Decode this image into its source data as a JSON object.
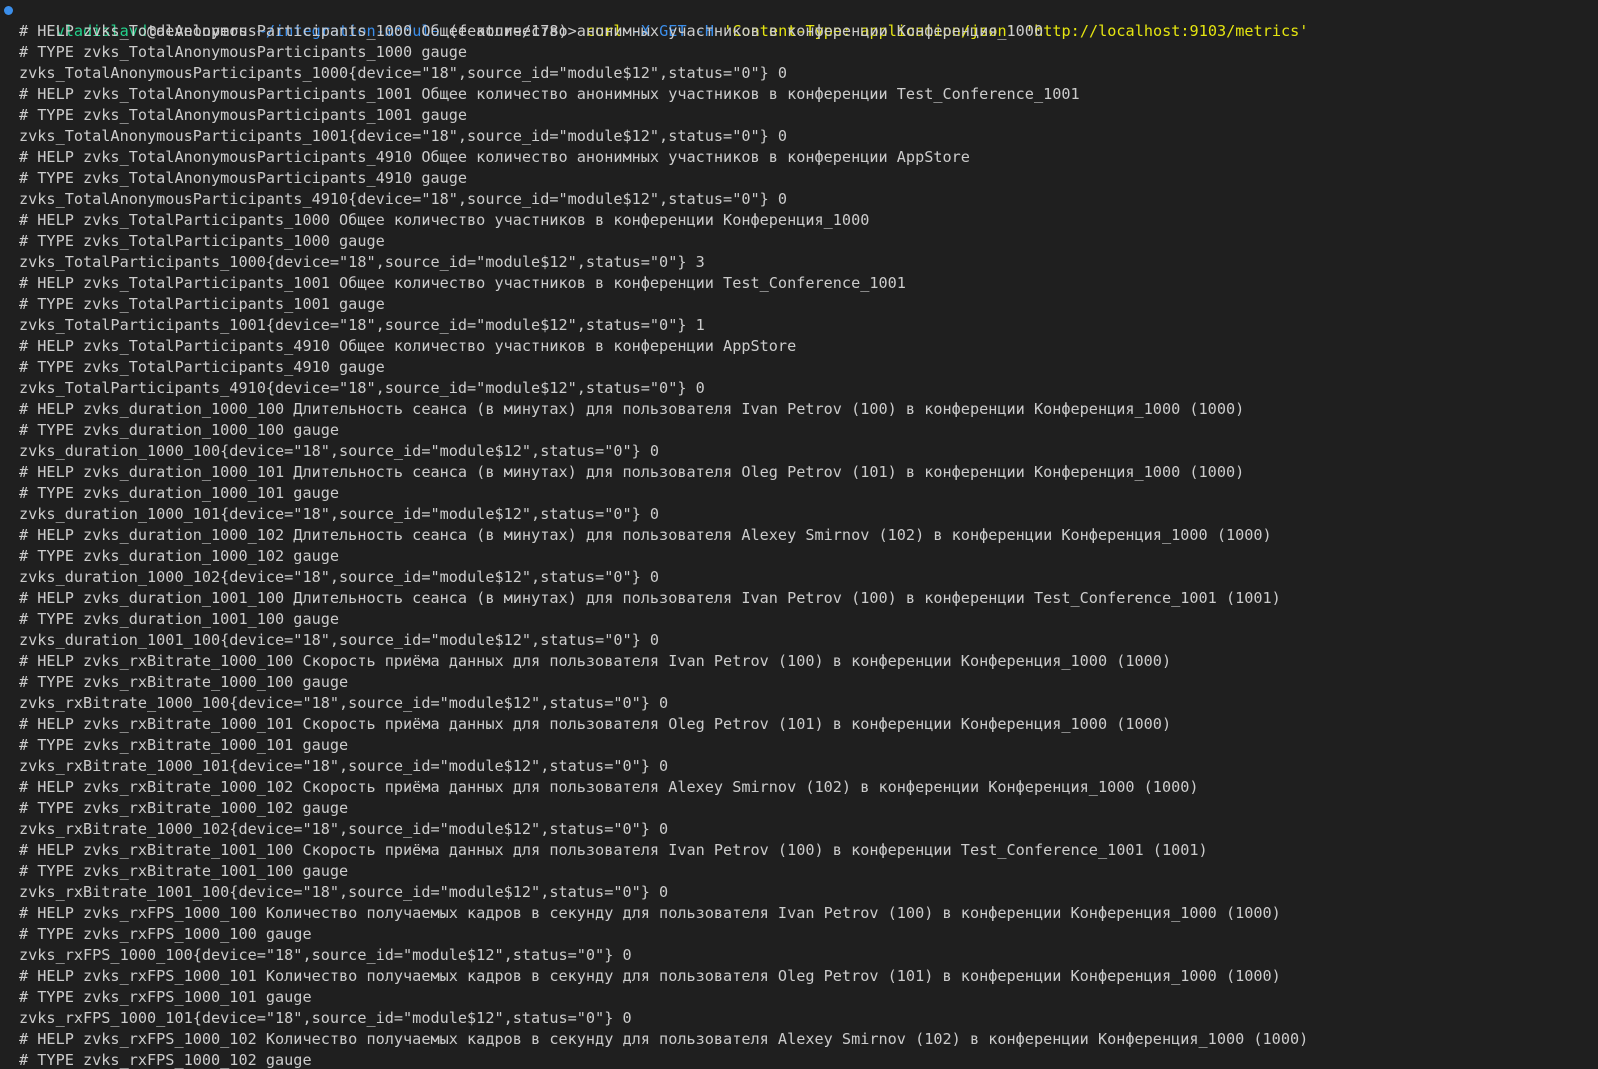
{
  "terminal": {
    "colors": {
      "background": "#1f1f1f",
      "foreground": "#cccccc",
      "prompt_dot": "#3b8eea"
    },
    "prompt": {
      "user": "vladislavd",
      "at_host": "@developers",
      "path": "~/integration-module",
      "branch": "(feature/178)>",
      "command": "curl",
      "flag_x": "-X",
      "method": "GET",
      "flag_h": "-H",
      "header": "'Content-Type: application/json'",
      "url": "'http://localhost:9103/metrics'"
    },
    "output": [
      "# HELP zvks_TotalAnonymousParticipants_1000 Общее количество анонимных участников в конференции Конференция_1000",
      "# TYPE zvks_TotalAnonymousParticipants_1000 gauge",
      "zvks_TotalAnonymousParticipants_1000{device=\"18\",source_id=\"module$12\",status=\"0\"} 0",
      "# HELP zvks_TotalAnonymousParticipants_1001 Общее количество анонимных участников в конференции Test_Conference_1001",
      "# TYPE zvks_TotalAnonymousParticipants_1001 gauge",
      "zvks_TotalAnonymousParticipants_1001{device=\"18\",source_id=\"module$12\",status=\"0\"} 0",
      "# HELP zvks_TotalAnonymousParticipants_4910 Общее количество анонимных участников в конференции AppStore",
      "# TYPE zvks_TotalAnonymousParticipants_4910 gauge",
      "zvks_TotalAnonymousParticipants_4910{device=\"18\",source_id=\"module$12\",status=\"0\"} 0",
      "# HELP zvks_TotalParticipants_1000 Общее количество участников в конференции Конференция_1000",
      "# TYPE zvks_TotalParticipants_1000 gauge",
      "zvks_TotalParticipants_1000{device=\"18\",source_id=\"module$12\",status=\"0\"} 3",
      "# HELP zvks_TotalParticipants_1001 Общее количество участников в конференции Test_Conference_1001",
      "# TYPE zvks_TotalParticipants_1001 gauge",
      "zvks_TotalParticipants_1001{device=\"18\",source_id=\"module$12\",status=\"0\"} 1",
      "# HELP zvks_TotalParticipants_4910 Общее количество участников в конференции AppStore",
      "# TYPE zvks_TotalParticipants_4910 gauge",
      "zvks_TotalParticipants_4910{device=\"18\",source_id=\"module$12\",status=\"0\"} 0",
      "# HELP zvks_duration_1000_100 Длительность сеанса (в минутах) для пользователя Ivan Petrov (100) в конференции Конференция_1000 (1000)",
      "# TYPE zvks_duration_1000_100 gauge",
      "zvks_duration_1000_100{device=\"18\",source_id=\"module$12\",status=\"0\"} 0",
      "# HELP zvks_duration_1000_101 Длительность сеанса (в минутах) для пользователя Oleg Petrov (101) в конференции Конференция_1000 (1000)",
      "# TYPE zvks_duration_1000_101 gauge",
      "zvks_duration_1000_101{device=\"18\",source_id=\"module$12\",status=\"0\"} 0",
      "# HELP zvks_duration_1000_102 Длительность сеанса (в минутах) для пользователя Alexey Smirnov (102) в конференции Конференция_1000 (1000)",
      "# TYPE zvks_duration_1000_102 gauge",
      "zvks_duration_1000_102{device=\"18\",source_id=\"module$12\",status=\"0\"} 0",
      "# HELP zvks_duration_1001_100 Длительность сеанса (в минутах) для пользователя Ivan Petrov (100) в конференции Test_Conference_1001 (1001)",
      "# TYPE zvks_duration_1001_100 gauge",
      "zvks_duration_1001_100{device=\"18\",source_id=\"module$12\",status=\"0\"} 0",
      "# HELP zvks_rxBitrate_1000_100 Скорость приёма данных для пользователя Ivan Petrov (100) в конференции Конференция_1000 (1000)",
      "# TYPE zvks_rxBitrate_1000_100 gauge",
      "zvks_rxBitrate_1000_100{device=\"18\",source_id=\"module$12\",status=\"0\"} 0",
      "# HELP zvks_rxBitrate_1000_101 Скорость приёма данных для пользователя Oleg Petrov (101) в конференции Конференция_1000 (1000)",
      "# TYPE zvks_rxBitrate_1000_101 gauge",
      "zvks_rxBitrate_1000_101{device=\"18\",source_id=\"module$12\",status=\"0\"} 0",
      "# HELP zvks_rxBitrate_1000_102 Скорость приёма данных для пользователя Alexey Smirnov (102) в конференции Конференция_1000 (1000)",
      "# TYPE zvks_rxBitrate_1000_102 gauge",
      "zvks_rxBitrate_1000_102{device=\"18\",source_id=\"module$12\",status=\"0\"} 0",
      "# HELP zvks_rxBitrate_1001_100 Скорость приёма данных для пользователя Ivan Petrov (100) в конференции Test_Conference_1001 (1001)",
      "# TYPE zvks_rxBitrate_1001_100 gauge",
      "zvks_rxBitrate_1001_100{device=\"18\",source_id=\"module$12\",status=\"0\"} 0",
      "# HELP zvks_rxFPS_1000_100 Количество получаемых кадров в секунду для пользователя Ivan Petrov (100) в конференции Конференция_1000 (1000)",
      "# TYPE zvks_rxFPS_1000_100 gauge",
      "zvks_rxFPS_1000_100{device=\"18\",source_id=\"module$12\",status=\"0\"} 0",
      "# HELP zvks_rxFPS_1000_101 Количество получаемых кадров в секунду для пользователя Oleg Petrov (101) в конференции Конференция_1000 (1000)",
      "# TYPE zvks_rxFPS_1000_101 gauge",
      "zvks_rxFPS_1000_101{device=\"18\",source_id=\"module$12\",status=\"0\"} 0",
      "# HELP zvks_rxFPS_1000_102 Количество получаемых кадров в секунду для пользователя Alexey Smirnov (102) в конференции Конференция_1000 (1000)",
      "# TYPE zvks_rxFPS_1000_102 gauge"
    ]
  }
}
